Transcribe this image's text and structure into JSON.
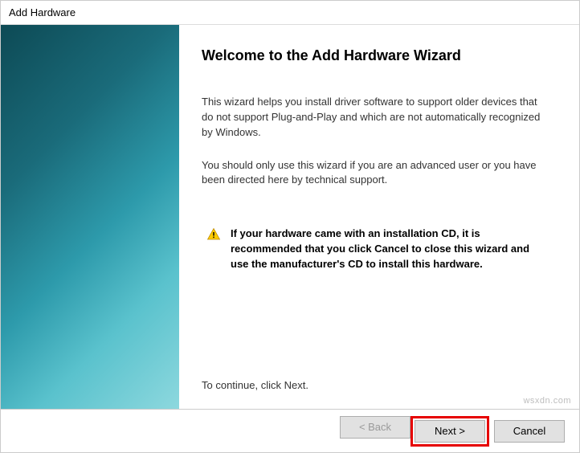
{
  "window": {
    "title": "Add Hardware"
  },
  "content": {
    "heading": "Welcome to the Add Hardware Wizard",
    "paragraph1": "This wizard helps you install driver software to support older devices that do not support Plug-and-Play and which are not automatically recognized by Windows.",
    "paragraph2": "You should only use this wizard if you are an advanced user or you have been directed here by technical support.",
    "warning": "If your hardware came with an installation CD, it is recommended that you click Cancel to close this wizard and use the manufacturer's CD to install this hardware.",
    "continue": "To continue, click Next."
  },
  "buttons": {
    "back": "< Back",
    "next": "Next >",
    "cancel": "Cancel"
  },
  "watermark": "wsxdn.com"
}
